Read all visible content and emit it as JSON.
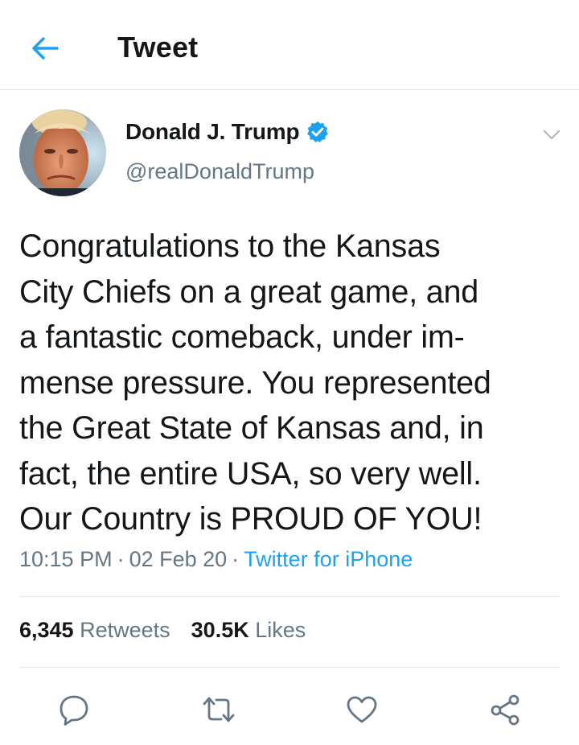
{
  "header": {
    "title": "Tweet",
    "back_icon": "arrow-left-icon",
    "accent_color": "#1da1f2"
  },
  "tweet": {
    "author": {
      "name": "Donald J. Trump",
      "handle": "@realDonaldTrump",
      "verified": true,
      "avatar_icon": "profile-photo"
    },
    "text": "Congratulations to the Kansas\nCity Chiefs on a great game, and\na fantastic comeback, under im-\nmense pressure. You represented\nthe Great State of Kansas and, in\nfact, the entire USA, so very well.\nOur Country is PROUD OF YOU!",
    "time": "10:15 PM",
    "date": "02 Feb 20",
    "separator": "·",
    "source": "Twitter for iPhone",
    "retweets_count": "6,345",
    "retweets_label": "Retweets",
    "likes_count": "30.5K",
    "likes_label": "Likes"
  },
  "actions": [
    {
      "name": "reply",
      "icon": "reply-icon"
    },
    {
      "name": "retweet",
      "icon": "retweet-icon"
    },
    {
      "name": "like",
      "icon": "heart-icon"
    },
    {
      "name": "share",
      "icon": "share-icon"
    }
  ],
  "colors": {
    "text_primary": "#14171a",
    "text_secondary": "#657786",
    "link": "#1da1f2",
    "divider": "#e1e8ed"
  }
}
